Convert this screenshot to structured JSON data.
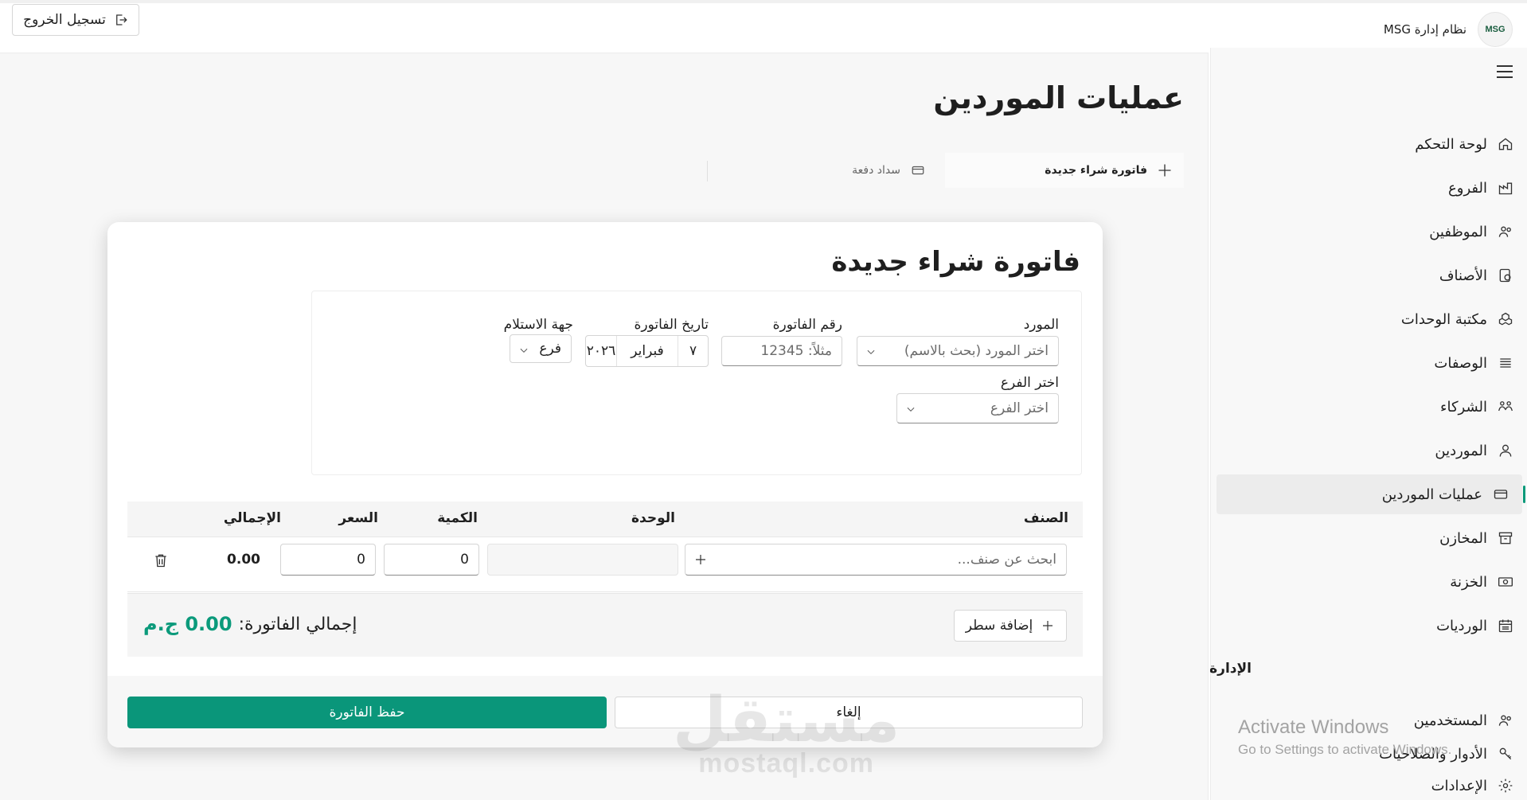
{
  "header": {
    "logout_label": "تسجيل الخروج",
    "brand_title": "نظام إدارة MSG",
    "brand_logo_text": "MSG"
  },
  "sidebar": {
    "items": [
      {
        "label": "لوحة التحكم",
        "icon": "home-icon"
      },
      {
        "label": "الفروع",
        "icon": "factory-icon"
      },
      {
        "label": "الموظفين",
        "icon": "people-icon"
      },
      {
        "label": "الأصناف",
        "icon": "box-icon"
      },
      {
        "label": "مكتبة الوحدات",
        "icon": "cubes-icon"
      },
      {
        "label": "الوصفات",
        "icon": "list-icon"
      },
      {
        "label": "الشركاء",
        "icon": "partners-icon"
      },
      {
        "label": "الموردين",
        "icon": "person-icon"
      },
      {
        "label": "عمليات الموردين",
        "icon": "card-icon",
        "active": true
      },
      {
        "label": "المخازن",
        "icon": "archive-icon"
      },
      {
        "label": "الخزنة",
        "icon": "money-icon"
      },
      {
        "label": "الورديات",
        "icon": "calendar-icon"
      }
    ],
    "admin_section_title": "الإدارة",
    "admin_items": [
      {
        "label": "المستخدمين",
        "icon": "users-icon"
      },
      {
        "label": "الأدوار والصلاحيات",
        "icon": "key-icon"
      },
      {
        "label": "الإعدادات",
        "icon": "gear-icon"
      }
    ]
  },
  "main": {
    "page_title": "عمليات الموردين",
    "tabs": [
      {
        "label": "فاتورة شراء جديدة",
        "icon": "plus-icon",
        "active": true
      },
      {
        "label": "سداد دفعة",
        "icon": "card-icon",
        "active": false
      }
    ]
  },
  "invoice": {
    "title": "فاتورة شراء جديدة",
    "supplier_label": "المورد",
    "supplier_placeholder": "اختر المورد (بحث بالاسم)",
    "invoice_number_label": "رقم الفاتورة",
    "invoice_number_placeholder": "مثلاً: 12345",
    "invoice_date_label": "تاريخ الفاتورة",
    "date_day": "٧",
    "date_month": "فبراير",
    "date_year": "٢٠٢٦",
    "receiver_label": "جهة الاستلام",
    "receiver_value": "فرع",
    "branch_label": "اختر الفرع",
    "branch_placeholder": "اختر الفرع",
    "columns": {
      "item": "الصنف",
      "unit": "الوحدة",
      "quantity": "الكمية",
      "price": "السعر",
      "total": "الإجمالي"
    },
    "row": {
      "item_placeholder": "ابحث عن صنف...",
      "unit": "",
      "quantity": "0",
      "price": "0",
      "total": "0.00"
    },
    "add_row_label": "إضافة سطر",
    "grand_total_label": "إجمالي الفاتورة:",
    "grand_total_value": "0.00 ج.م",
    "cancel_label": "إلغاء",
    "save_label": "حفظ الفاتورة"
  },
  "overlay": {
    "activate_title": "Activate Windows",
    "activate_subtitle": "Go to Settings to activate Windows.",
    "watermark_ar": "مستقل",
    "watermark_en": "mostaql.com"
  },
  "colors": {
    "accent": "#0a967a",
    "total_green": "#0b9a7b"
  }
}
